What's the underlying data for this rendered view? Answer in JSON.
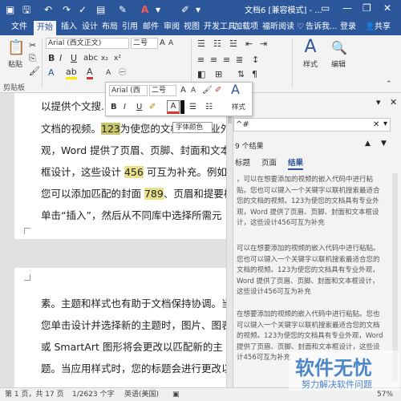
{
  "titlebar": {
    "title": "文档6 [兼容模式] - ...",
    "icons": [
      "save-icon",
      "undo-icon",
      "redo-icon",
      "font-color-icon",
      "highlight-icon"
    ],
    "window_buttons": [
      "ribbon-options-icon",
      "minimize-icon",
      "restore-icon",
      "close-icon"
    ]
  },
  "tabs": [
    "文件",
    "开始",
    "插入",
    "设计",
    "布局",
    "引用",
    "邮件",
    "审阅",
    "视图",
    "开发工具",
    "加载项",
    "福昕阅读"
  ],
  "active_tab": "开始",
  "tell_me": "告诉我...",
  "login": "登录",
  "share": "共享",
  "ribbon": {
    "paste_label": "粘贴",
    "clipboard_group": "剪贴板",
    "font_name": "Arial (西文正文)",
    "font_size": "二号",
    "paragraph_group": "段落",
    "styles_label": "样式",
    "edit_label": "编辑"
  },
  "document": {
    "page1_lines": [
      {
        "pre": "以提供",
        "hl": "",
        "post": "个文搜...",
        "hlclass": ""
      },
      {
        "pre": "文档的视频。",
        "hl": "123",
        "post": "为使您的文档具有专业外",
        "hlclass": "hl2"
      },
      {
        "pre": "观，Word 提供了页眉、页脚、封面和文本",
        "hl": "",
        "post": "",
        "hlclass": ""
      },
      {
        "pre": "框设计，这些设计 ",
        "hl": "456",
        "post": " 可互为补充。例如，",
        "hlclass": "hl"
      },
      {
        "pre": "您可以添加匹配的封面 ",
        "hl": "789",
        "post": "、页眉和提要栏。",
        "hlclass": "hl"
      },
      {
        "pre": "单击“插入”，然后从不同库中选择所需元",
        "hl": "",
        "post": "",
        "hlclass": ""
      }
    ],
    "page2_lines": [
      "素。主题和样式也有助于文档保持协调。当",
      "您单击设计并选择新的主题时，图片、图表",
      "或 SmartArt 图形将会更改以匹配新的主",
      "题。当应用样式时，您的标题会进行更改以"
    ]
  },
  "mini_toolbar": {
    "font_name": "Arial (西",
    "font_size": "二号",
    "styles_label": "样式",
    "tooltip": "字体颜色"
  },
  "nav_pane": {
    "search_value": "^#",
    "result_count": "9 个结果",
    "tabs": [
      "标题",
      "页面",
      "结果"
    ],
    "active_tab": "结果",
    "results": [
      "，可以在想要添加的视频的嵌入代码中进行粘贴。您也可以键入一个关键字以联机搜索最适合您的文档的视频。123为使您的文档具有专业外观，Word 提供了页眉、页脚、封面和文本框设计，这些设计456可互为补充",
      "可以在想要添加的视频的嵌入代码中进行粘贴。您也可以键入一个关键字以联机搜索最适合您的文档的视频。123为使您的文档具有专业外观，Word 提供了页眉、页脚、封面和文本框设计，这些设计456可互为补充",
      "在想要添加的视频的嵌入代码中进行粘贴。您也可以键入一个关键字以联机搜索最适合您的文档的视频。123为使您的文档具有专业外观，Word 提供了页眉、页脚、封面和文本框设计，这些设计456可互为补充"
    ]
  },
  "status": {
    "page": "第 1 页，共 17 页",
    "words": "1/2623 个字",
    "language": "英语(美国)",
    "zoom": "57%"
  },
  "watermark": {
    "main": "软件无忧",
    "sub": "努力解决软件问题"
  },
  "colors": {
    "accent": "#2b579a",
    "highlight": "#e8e28a",
    "font_color": "#d9332b"
  }
}
